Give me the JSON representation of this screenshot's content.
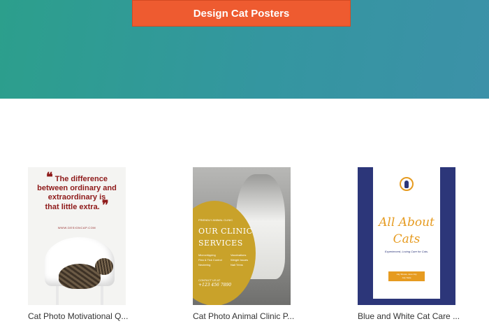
{
  "hero": {
    "cta_label": "Design Cat Posters"
  },
  "templates": [
    {
      "title": "Cat Photo Motivational Q...",
      "poster": {
        "quote_line1": "The difference",
        "quote_line2": "between ordinary and",
        "quote_line3": "extraordinary is",
        "quote_line4": "that little extra.",
        "site": "WWW.DESIGNCAP.COM"
      }
    },
    {
      "title": "Cat Photo Animal Clinic P...",
      "poster": {
        "brand": "FRIENDLY ANIMAL CLINIC",
        "heading_line1": "OUR CLINIC",
        "heading_line2": "SERVICES",
        "services": [
          "Microchipping",
          "Vaccinations",
          "Flea & Tick Control",
          "Weight Issues",
          "Neutering",
          "Nail Trims"
        ],
        "contact_label": "CONTACT US AT",
        "phone": "+123 456 7890"
      }
    },
    {
      "title": "Blue and White Cat Care ...",
      "poster": {
        "heading_line1": "All About",
        "heading_line2": "Cats",
        "tagline": "Experienced, Loving Care for Cats.",
        "button_line1": "July Shows, June City",
        "button_line2": "July State"
      }
    }
  ],
  "colors": {
    "hero_start": "#2c9f8c",
    "hero_end": "#3c91a8",
    "cta": "#ee5b30",
    "poster_navy": "#2c3679",
    "poster_orange": "#e69b20",
    "poster_gold": "#c9a22a",
    "quote_red": "#8e1a1a"
  }
}
